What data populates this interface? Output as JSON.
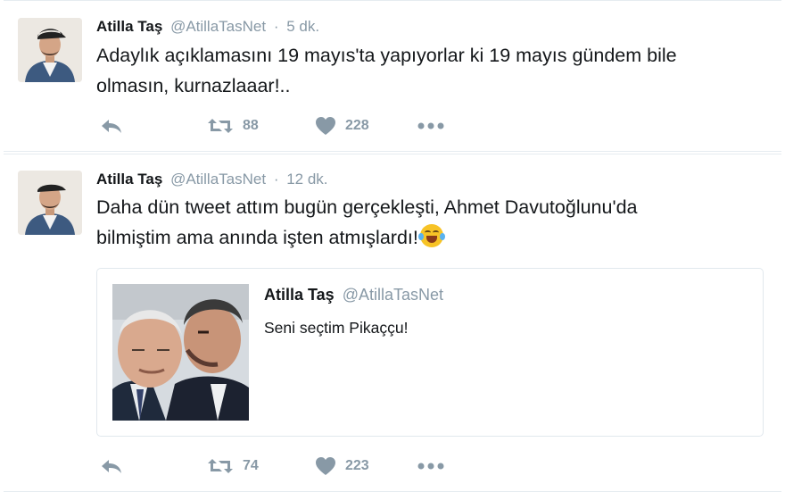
{
  "tweets": [
    {
      "name": "Atilla Taş",
      "handle": "@AtillaTasNet",
      "dot": "·",
      "time": "5 dk.",
      "text_line1": "Adaylık açıklamasını 19 mayıs'ta yapıyorlar ki 19 mayıs gündem bile",
      "text_line2": "olmasın, kurnazlaaar!..",
      "retweets": "88",
      "likes": "228"
    },
    {
      "name": "Atilla Taş",
      "handle": "@AtillaTasNet",
      "dot": "·",
      "time": "12 dk.",
      "text_line1": "Daha dün tweet attım bugün gerçekleşti, Ahmet Davutoğlunu'da",
      "text_line2": "bilmiştim ama anında işten atmışlardı!",
      "emoji": "face-with-tears-of-joy",
      "retweets": "74",
      "likes": "223",
      "quote": {
        "name": "Atilla Taş",
        "handle": "@AtillaTasNet",
        "text": "Seni seçtim Pikaççu!"
      }
    }
  ],
  "icons": {
    "reply": "reply-icon",
    "retweet": "retweet-icon",
    "like": "heart-icon",
    "more": "more-dots-icon"
  },
  "colors": {
    "name": "#14171a",
    "muted": "#8899a6",
    "border": "#e6ecf0"
  }
}
